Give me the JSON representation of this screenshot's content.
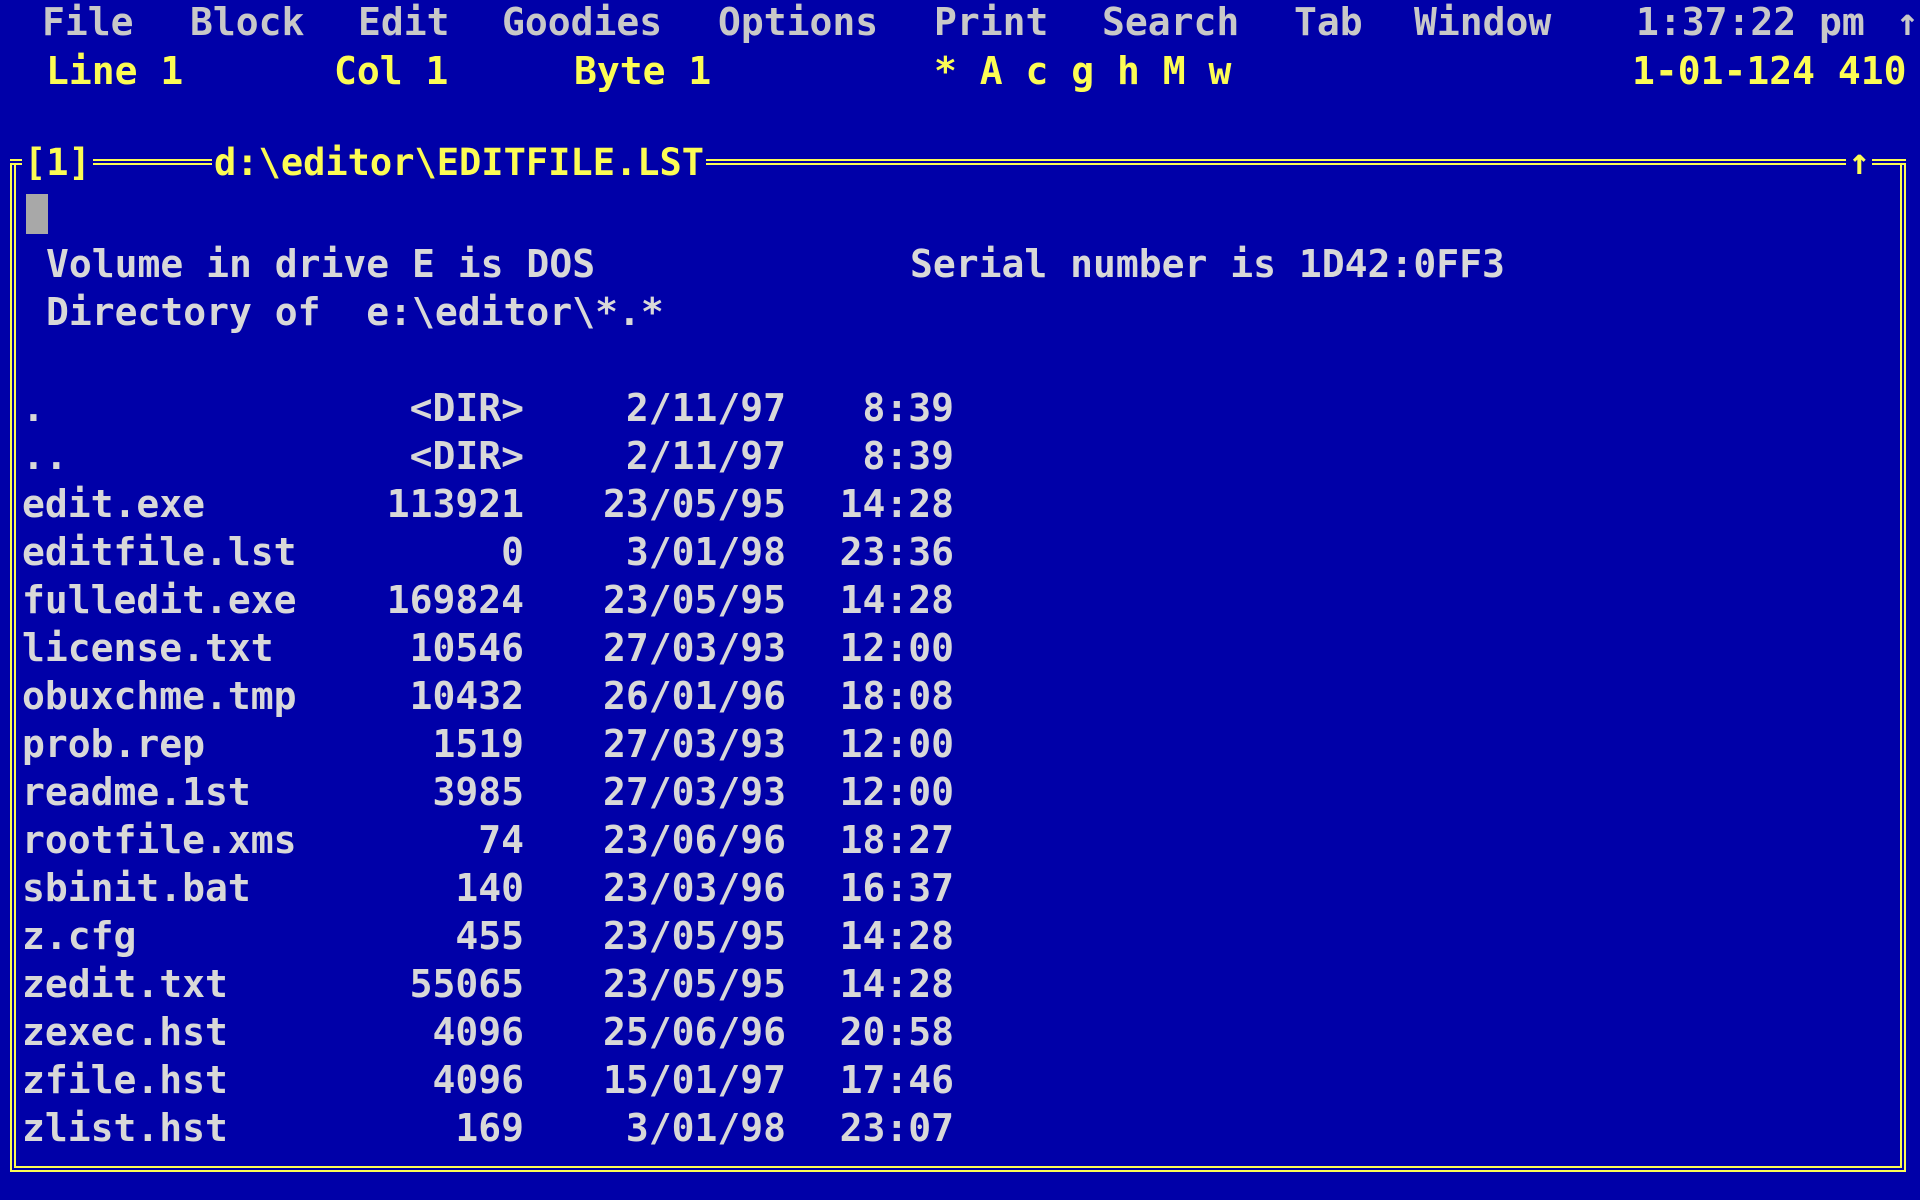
{
  "menu": {
    "items": [
      "File",
      "Block",
      "Edit",
      "Goodies",
      "Options",
      "Print",
      "Search",
      "Tab",
      "Window"
    ],
    "clock": "1:37:22 pm",
    "scroll_glyph": "↑"
  },
  "status": {
    "line": "Line 1",
    "col": "Col 1",
    "byte": "Byte 1",
    "flags": "* A c g h M w",
    "date_info": "1-01-124 410"
  },
  "window": {
    "number": "[1]",
    "path": "d:\\editor\\EDITFILE.LST",
    "scroll_arrow": "↑"
  },
  "listing": {
    "volume": "Volume in drive E is DOS",
    "serial": "Serial number is 1D42:0FF3",
    "directory": "Directory of  e:\\editor\\*.*",
    "rows": [
      {
        "name": ".",
        "size": "<DIR>",
        "date": "2/11/97",
        "time": "8:39"
      },
      {
        "name": "..",
        "size": "<DIR>",
        "date": "2/11/97",
        "time": "8:39"
      },
      {
        "name": "edit.exe",
        "size": "113921",
        "date": "23/05/95",
        "time": "14:28"
      },
      {
        "name": "editfile.lst",
        "size": "0",
        "date": "3/01/98",
        "time": "23:36"
      },
      {
        "name": "fulledit.exe",
        "size": "169824",
        "date": "23/05/95",
        "time": "14:28"
      },
      {
        "name": "license.txt",
        "size": "10546",
        "date": "27/03/93",
        "time": "12:00"
      },
      {
        "name": "obuxchme.tmp",
        "size": "10432",
        "date": "26/01/96",
        "time": "18:08"
      },
      {
        "name": "prob.rep",
        "size": "1519",
        "date": "27/03/93",
        "time": "12:00"
      },
      {
        "name": "readme.1st",
        "size": "3985",
        "date": "27/03/93",
        "time": "12:00"
      },
      {
        "name": "rootfile.xms",
        "size": "74",
        "date": "23/06/96",
        "time": "18:27"
      },
      {
        "name": "sbinit.bat",
        "size": "140",
        "date": "23/03/96",
        "time": "16:37"
      },
      {
        "name": "z.cfg",
        "size": "455",
        "date": "23/05/95",
        "time": "14:28"
      },
      {
        "name": "zedit.txt",
        "size": "55065",
        "date": "23/05/95",
        "time": "14:28"
      },
      {
        "name": "zexec.hst",
        "size": "4096",
        "date": "25/06/96",
        "time": "20:58"
      },
      {
        "name": "zfile.hst",
        "size": "4096",
        "date": "15/01/97",
        "time": "17:46"
      },
      {
        "name": "zlist.hst",
        "size": "169",
        "date": "3/01/98",
        "time": "23:07"
      }
    ]
  },
  "colors": {
    "background": "#0000a8",
    "frame": "#fcfc54",
    "menu_text": "#c8c8c8",
    "body_text": "#d8d8d8",
    "cursor": "#a8a8a8"
  }
}
